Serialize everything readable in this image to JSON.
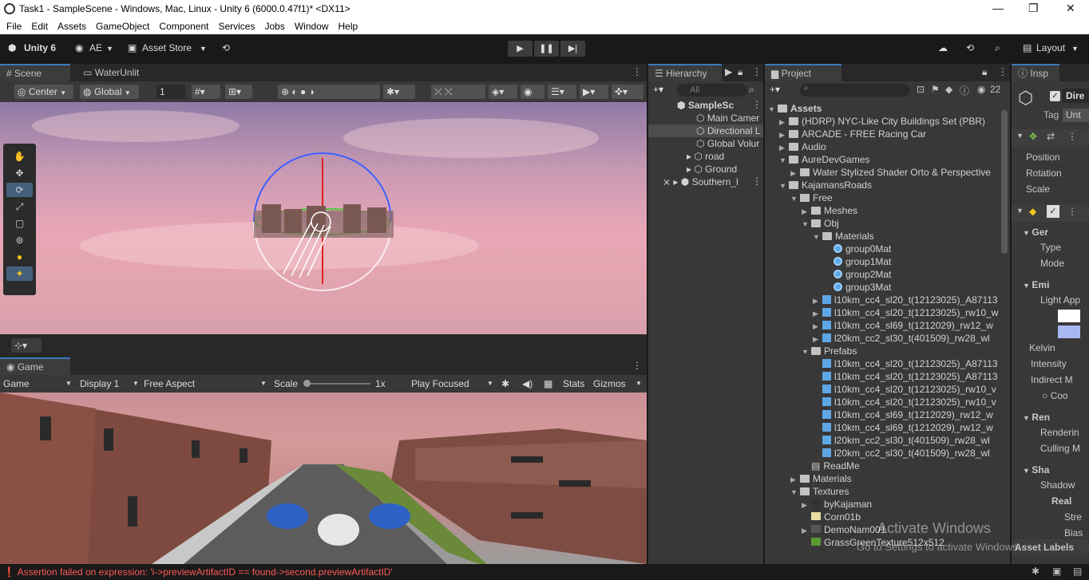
{
  "window": {
    "title": "Task1 - SampleScene - Windows, Mac, Linux - Unity 6 (6000.0.47f1)* <DX11>",
    "controls": [
      "—",
      "❐",
      "✕"
    ]
  },
  "menu": [
    "File",
    "Edit",
    "Assets",
    "GameObject",
    "Component",
    "Services",
    "Jobs",
    "Window",
    "Help"
  ],
  "toolbar": {
    "unity_label": "Unity 6",
    "account_label": "AE",
    "asset_store_label": "Asset Store",
    "layout_label": "Layout"
  },
  "scene": {
    "tabs": [
      "Scene",
      "WaterUnlit"
    ],
    "pivot_label": "Center",
    "space_label": "Global",
    "grid_value": "1"
  },
  "game": {
    "tab": "Game",
    "mode": "Game",
    "display": "Display 1",
    "aspect": "Free Aspect",
    "scale_label": "Scale",
    "scale_value": "1x",
    "play_mode": "Play Focused",
    "stats_label": "Stats",
    "gizmos_label": "Gizmos"
  },
  "hierarchy": {
    "tab": "Hierarchy",
    "search_placeholder": "All",
    "items": [
      {
        "label": "SampleSc",
        "depth": 0,
        "bold": true
      },
      {
        "label": "Main Camer",
        "depth": 1
      },
      {
        "label": "Directional L",
        "depth": 1,
        "selected": true
      },
      {
        "label": "Global Volur",
        "depth": 1
      },
      {
        "label": "road",
        "depth": 1
      },
      {
        "label": "Ground",
        "depth": 1
      },
      {
        "label": "Southern_l",
        "depth": 0
      }
    ]
  },
  "project": {
    "tab": "Project",
    "hidden_count": "22",
    "items": [
      {
        "label": "Assets",
        "depth": 0,
        "kind": "folder",
        "bold": true
      },
      {
        "label": "(HDRP) NYC-Like City Buildings Set (PBR)",
        "depth": 1,
        "kind": "folder"
      },
      {
        "label": "ARCADE - FREE Racing Car",
        "depth": 1,
        "kind": "folder"
      },
      {
        "label": "Audio",
        "depth": 1,
        "kind": "folder"
      },
      {
        "label": "AureDevGames",
        "depth": 1,
        "kind": "folder"
      },
      {
        "label": "Water Stylized Shader Orto & Perspective",
        "depth": 2,
        "kind": "folder"
      },
      {
        "label": "KajamansRoads",
        "depth": 1,
        "kind": "folder"
      },
      {
        "label": "Free",
        "depth": 2,
        "kind": "folder"
      },
      {
        "label": "Meshes",
        "depth": 3,
        "kind": "folder"
      },
      {
        "label": "Obj",
        "depth": 3,
        "kind": "folder"
      },
      {
        "label": "Materials",
        "depth": 4,
        "kind": "folder"
      },
      {
        "label": "group0Mat",
        "depth": 5,
        "kind": "material"
      },
      {
        "label": "group1Mat",
        "depth": 5,
        "kind": "material"
      },
      {
        "label": "group2Mat",
        "depth": 5,
        "kind": "material"
      },
      {
        "label": "group3Mat",
        "depth": 5,
        "kind": "material"
      },
      {
        "label": "l10km_cc4_sl20_t(12123025)_A87113",
        "depth": 4,
        "kind": "model"
      },
      {
        "label": "l10km_cc4_sl20_t(12123025)_rw10_w",
        "depth": 4,
        "kind": "model"
      },
      {
        "label": "l10km_cc4_sl69_t(1212029)_rw12_w",
        "depth": 4,
        "kind": "model"
      },
      {
        "label": "l20km_cc2_sl30_t(401509)_rw28_wl",
        "depth": 4,
        "kind": "model"
      },
      {
        "label": "Prefabs",
        "depth": 3,
        "kind": "folder"
      },
      {
        "label": "l10km_cc4_sl20_t(12123025)_A87113",
        "depth": 4,
        "kind": "prefab"
      },
      {
        "label": "l10km_cc4_sl20_t(12123025)_A87113",
        "depth": 4,
        "kind": "prefab"
      },
      {
        "label": "l10km_cc4_sl20_t(12123025)_rw10_v",
        "depth": 4,
        "kind": "prefab"
      },
      {
        "label": "l10km_cc4_sl20_t(12123025)_rw10_v",
        "depth": 4,
        "kind": "prefab"
      },
      {
        "label": "l10km_cc4_sl69_t(1212029)_rw12_w",
        "depth": 4,
        "kind": "prefab"
      },
      {
        "label": "l10km_cc4_sl69_t(1212029)_rw12_w",
        "depth": 4,
        "kind": "prefab"
      },
      {
        "label": "l20km_cc2_sl30_t(401509)_rw28_wl",
        "depth": 4,
        "kind": "prefab"
      },
      {
        "label": "l20km_cc2_sl30_t(401509)_rw28_wl",
        "depth": 4,
        "kind": "prefab"
      },
      {
        "label": "ReadMe",
        "depth": 3,
        "kind": "doc"
      },
      {
        "label": "Materials",
        "depth": 2,
        "kind": "folder"
      },
      {
        "label": "Textures",
        "depth": 2,
        "kind": "folder"
      },
      {
        "label": "byKajaman",
        "depth": 3,
        "kind": "texture"
      },
      {
        "label": "Corn01b",
        "depth": 3,
        "kind": "texture"
      },
      {
        "label": "DemoNam001",
        "depth": 3,
        "kind": "texture"
      },
      {
        "label": "GrassGreenTexture512x512",
        "depth": 3,
        "kind": "texture"
      }
    ]
  },
  "inspector": {
    "tab": "Insp",
    "object_name": "Dire",
    "tag_label": "Tag",
    "tag_value": "Unt",
    "rows": [
      {
        "label": "Position",
        "indent": 1
      },
      {
        "label": "Rotation",
        "indent": 1
      },
      {
        "label": "Scale",
        "indent": 1
      },
      {
        "label": "Ger",
        "indent": 1,
        "bold": true
      },
      {
        "label": "Type",
        "indent": 2
      },
      {
        "label": "Mode",
        "indent": 2
      },
      {
        "label": "Emi",
        "indent": 1,
        "bold": true
      },
      {
        "label": "Light App",
        "indent": 2
      },
      {
        "label": "Kelvin",
        "indent": 1
      },
      {
        "label": "Intensity",
        "indent": 1
      },
      {
        "label": "Indirect M",
        "indent": 1
      },
      {
        "label": "○ Coo",
        "indent": 3
      },
      {
        "label": "Ren",
        "indent": 1,
        "bold": true
      },
      {
        "label": "Renderin",
        "indent": 2
      },
      {
        "label": "Culling M",
        "indent": 2
      },
      {
        "label": "Sha",
        "indent": 1,
        "bold": true
      },
      {
        "label": "Shadow",
        "indent": 1
      },
      {
        "label": "Real",
        "indent": 2,
        "bold": true
      },
      {
        "label": "Stre",
        "indent": 3
      },
      {
        "label": "Bias",
        "indent": 3
      }
    ],
    "asset_labels": "Asset Labels"
  },
  "status": {
    "error": "Assertion failed on expression: 'i->previewArtifactID == found->second.previewArtifactID'"
  },
  "watermark": {
    "line1": "Activate Windows",
    "line2": "Go to Settings to activate Windows."
  },
  "colors": {
    "accent": "#3a79bb",
    "error": "#ff5a5a",
    "panel": "#383838",
    "selection": "#2c5d87"
  }
}
